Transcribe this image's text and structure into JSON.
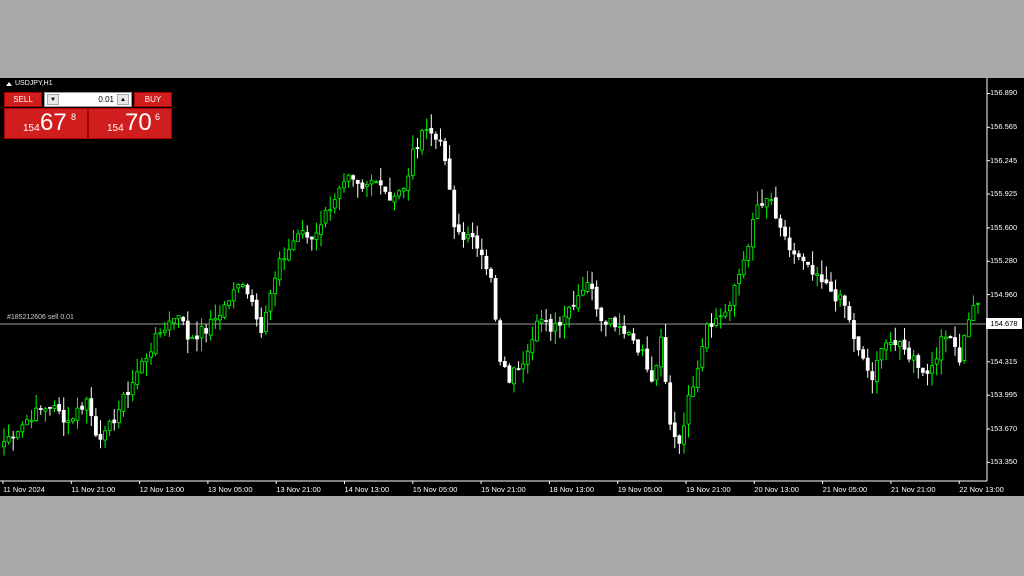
{
  "window": {
    "title": "USDJPY,H1"
  },
  "trade_panel": {
    "sell_label": "SELL",
    "buy_label": "BUY",
    "lot_value": "0.01",
    "sell_price": {
      "small": "154",
      "big": "67",
      "sup": "8"
    },
    "buy_price": {
      "small": "154",
      "big": "70",
      "sup": "6"
    }
  },
  "order_line": {
    "label": "#185212606 sell 0.01",
    "price": "154.678"
  },
  "colors": {
    "background": "#000000",
    "bull": "#00ff00",
    "bear": "#ffffff",
    "sell_button": "#d01d1d",
    "order_line": "#8fa08f"
  },
  "y_axis": [
    "156.890",
    "156.565",
    "156.245",
    "155.925",
    "155.600",
    "155.280",
    "154.960",
    "154.678",
    "154.315",
    "153.995",
    "153.670",
    "153.350"
  ],
  "x_axis": [
    "11 Nov 2024",
    "11 Nov 21:00",
    "12 Nov 13:00",
    "13 Nov 05:00",
    "13 Nov 21:00",
    "14 Nov 13:00",
    "15 Nov 05:00",
    "15 Nov 21:00",
    "18 Nov 13:00",
    "19 Nov 05:00",
    "19 Nov 21:00",
    "20 Nov 13:00",
    "21 Nov 05:00",
    "21 Nov 21:00",
    "22 Nov 13:00"
  ],
  "chart_data": {
    "type": "candlestick",
    "symbol": "USDJPY",
    "timeframe": "H1",
    "ylim": [
      153.2,
      157.0
    ],
    "close_anchors": [
      [
        0,
        153.55
      ],
      [
        6,
        153.8
      ],
      [
        10,
        153.9
      ],
      [
        14,
        153.75
      ],
      [
        18,
        153.95
      ],
      [
        20,
        153.65
      ],
      [
        22,
        153.6
      ],
      [
        26,
        153.95
      ],
      [
        30,
        154.3
      ],
      [
        34,
        154.6
      ],
      [
        38,
        154.8
      ],
      [
        40,
        154.55
      ],
      [
        44,
        154.62
      ],
      [
        48,
        154.85
      ],
      [
        52,
        155.1
      ],
      [
        54,
        154.9
      ],
      [
        56,
        154.65
      ],
      [
        60,
        155.25
      ],
      [
        64,
        155.55
      ],
      [
        67,
        155.5
      ],
      [
        72,
        155.9
      ],
      [
        75,
        156.05
      ],
      [
        78,
        155.95
      ],
      [
        81,
        156.1
      ],
      [
        84,
        155.9
      ],
      [
        87,
        155.95
      ],
      [
        89,
        156.3
      ],
      [
        91,
        156.55
      ],
      [
        94,
        156.5
      ],
      [
        96,
        156.25
      ],
      [
        98,
        155.6
      ],
      [
        101,
        155.5
      ],
      [
        104,
        155.4
      ],
      [
        106,
        155.1
      ],
      [
        108,
        154.3
      ],
      [
        110,
        154.15
      ],
      [
        113,
        154.35
      ],
      [
        116,
        154.7
      ],
      [
        119,
        154.65
      ],
      [
        121,
        154.72
      ],
      [
        124,
        154.9
      ],
      [
        127,
        155.1
      ],
      [
        130,
        154.75
      ],
      [
        133,
        154.7
      ],
      [
        136,
        154.6
      ],
      [
        139,
        154.4
      ],
      [
        141,
        154.1
      ],
      [
        143,
        154.5
      ],
      [
        145,
        153.7
      ],
      [
        147,
        153.55
      ],
      [
        149,
        153.95
      ],
      [
        151,
        154.3
      ],
      [
        153,
        154.7
      ],
      [
        155,
        154.72
      ],
      [
        158,
        154.85
      ],
      [
        161,
        155.3
      ],
      [
        164,
        155.8
      ],
      [
        167,
        155.85
      ],
      [
        169,
        155.55
      ],
      [
        171,
        155.4
      ],
      [
        174,
        155.25
      ],
      [
        177,
        155.1
      ],
      [
        180,
        155.0
      ],
      [
        183,
        154.85
      ],
      [
        186,
        154.4
      ],
      [
        189,
        154.15
      ],
      [
        192,
        154.55
      ],
      [
        195,
        154.45
      ],
      [
        198,
        154.35
      ],
      [
        201,
        154.2
      ],
      [
        204,
        154.5
      ],
      [
        206,
        154.6
      ],
      [
        208,
        154.35
      ],
      [
        210,
        154.75
      ],
      [
        212,
        154.9
      ]
    ],
    "note_bullish": "green",
    "note_bearish": "white"
  }
}
